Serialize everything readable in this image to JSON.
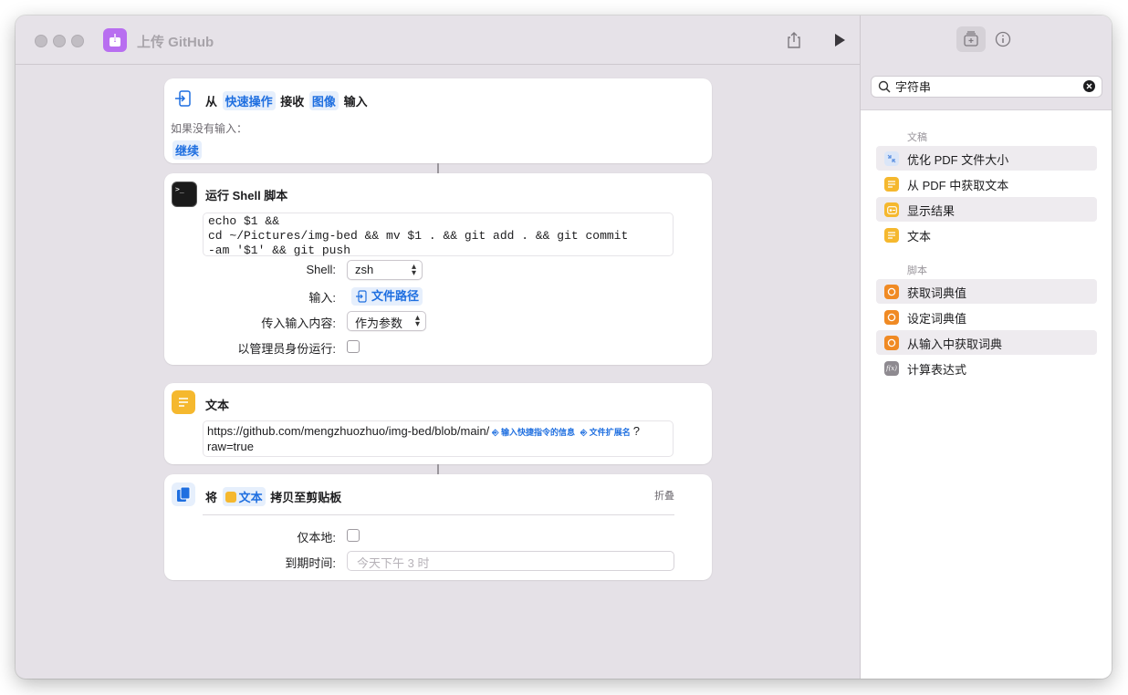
{
  "window": {
    "title": "上传 GitHub"
  },
  "actions": {
    "receive": {
      "from_label": "从",
      "source_token": "快速操作",
      "receive_label": "接收",
      "type_token": "图像",
      "input_label": "输入",
      "no_input_label": "如果没有输入：",
      "no_input_action": "继续"
    },
    "shell": {
      "title": "运行 Shell 脚本",
      "script_lines": [
        "echo $1 &&",
        "cd ~/Pictures/img-bed && mv $1 . && git add . && git commit",
        "-am '$1' && git push"
      ],
      "shell_label": "Shell:",
      "shell_value": "zsh",
      "input_label": "输入:",
      "input_value": "文件路径",
      "pass_input_label": "传入输入内容:",
      "pass_input_value": "作为参数",
      "run_as_admin_label": "以管理员身份运行:"
    },
    "text": {
      "title": "文本",
      "url_prefix": "https://github.com/mengzhuozhuo/img-bed/blob/main/",
      "var1": "输入快捷指令的信息",
      "var2": "文件扩展名",
      "url_q": "?",
      "url_suffix": "raw=true"
    },
    "clipboard": {
      "label_prefix": "将",
      "token": "文本",
      "label_suffix": "拷贝至剪贴板",
      "collapse_label": "折叠",
      "local_only_label": "仅本地:",
      "expire_label": "到期时间:",
      "expire_placeholder": "今天下午 3 时"
    }
  },
  "sidebar": {
    "search_value": "字符串",
    "sections": [
      {
        "title": "文稿",
        "items": [
          {
            "label": "优化 PDF 文件大小",
            "icon": "pdf-compress-icon",
            "color": "#5b8fe0"
          },
          {
            "label": "从 PDF 中获取文本",
            "icon": "text-doc-icon",
            "color": "#f5b82e"
          },
          {
            "label": "显示结果",
            "icon": "show-result-icon",
            "color": "#f5b82e"
          },
          {
            "label": "文本",
            "icon": "text-doc-icon",
            "color": "#f5b82e"
          }
        ]
      },
      {
        "title": "脚本",
        "items": [
          {
            "label": "获取词典值",
            "icon": "dictionary-icon",
            "color": "#f08a24"
          },
          {
            "label": "设定词典值",
            "icon": "dictionary-icon",
            "color": "#f08a24"
          },
          {
            "label": "从输入中获取词典",
            "icon": "dictionary-icon",
            "color": "#f08a24"
          },
          {
            "label": "计算表达式",
            "icon": "function-icon",
            "color": "#8e8a90"
          }
        ]
      }
    ]
  },
  "colors": {
    "accent": "#1f6fe0",
    "app_icon": "#b86ef0",
    "window_bg": "#e5e1e7"
  }
}
